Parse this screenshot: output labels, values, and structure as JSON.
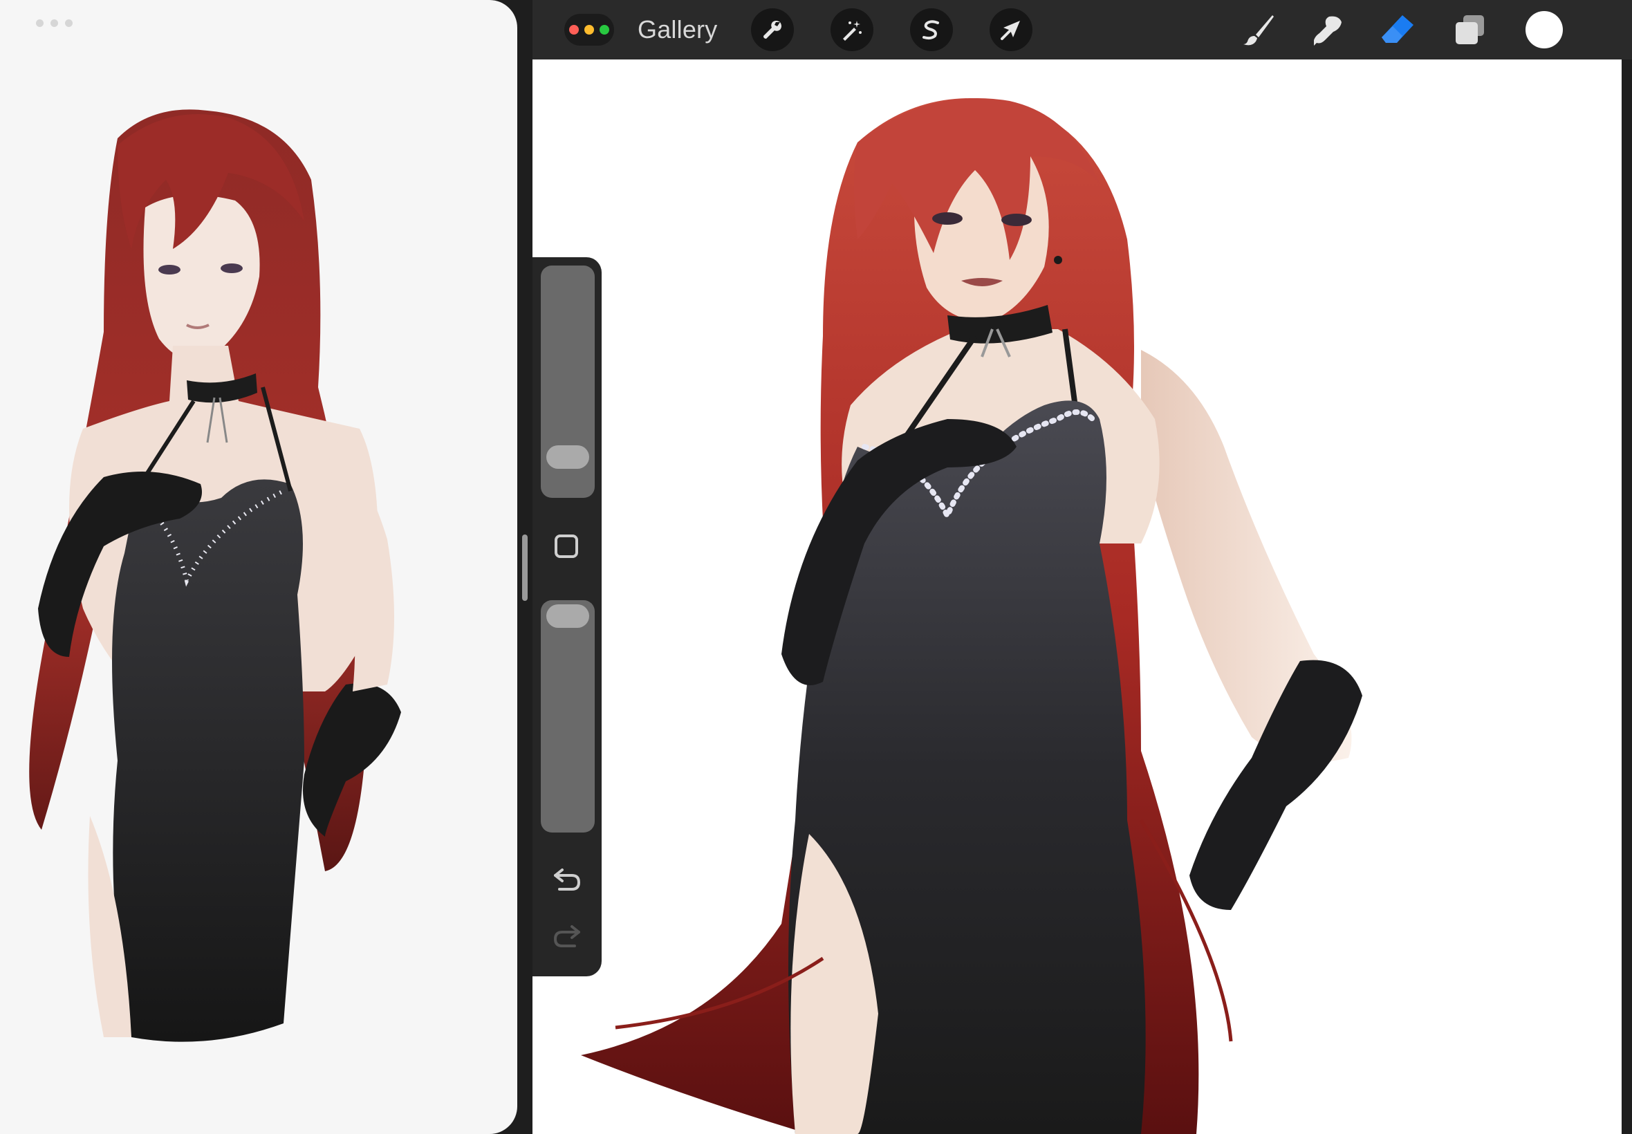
{
  "toolbar": {
    "gallery_label": "Gallery",
    "window_dot_colors": [
      "#ff5f57",
      "#febc2e",
      "#28c840"
    ],
    "left_tools": [
      "actions-wrench-icon",
      "adjustments-magic-wand-icon",
      "selection-s-icon",
      "transform-arrow-icon"
    ],
    "right_tools": [
      "brush-icon",
      "smudge-icon",
      "eraser-icon",
      "layers-icon"
    ],
    "active_tool": "eraser-icon",
    "active_color": "#ffffff",
    "accent": "#1a7cf2"
  },
  "sidebar": {
    "brush_size_level": 0.13,
    "opacity_level": 1.0,
    "buttons": [
      "modify-square-icon",
      "undo-icon",
      "redo-icon"
    ]
  },
  "left_app": {
    "multitask_dots": 3
  },
  "colors": {
    "hair": "#b3342a",
    "dress": "#2a2a2e",
    "skin": "#f1dfd5",
    "toolbar_bg": "#2a2a2a"
  }
}
